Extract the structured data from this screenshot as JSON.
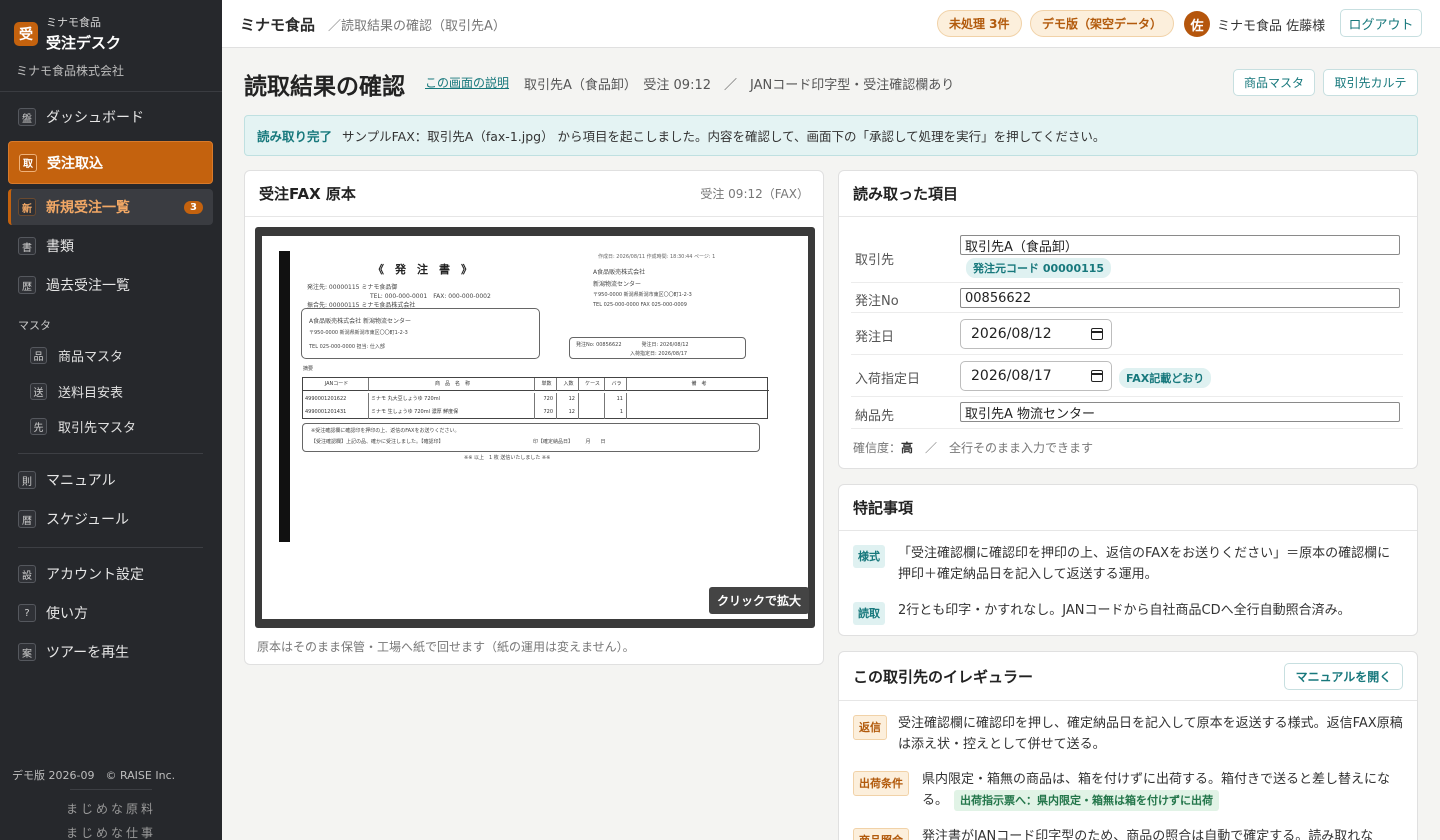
{
  "sidebar": {
    "brand_sub": "ミナモ食品",
    "brand_main": "受注デスク",
    "brand_logo": "受",
    "company": "ミナモ食品株式会社",
    "items": [
      {
        "icon": "盤",
        "label": "ダッシュボード"
      },
      {
        "icon": "取",
        "label": "受注取込"
      },
      {
        "icon": "新",
        "label": "新規受注一覧",
        "badge": "3"
      },
      {
        "icon": "書",
        "label": "書類"
      },
      {
        "icon": "歴",
        "label": "過去受注一覧"
      }
    ],
    "master_section": "マスタ",
    "master_items": [
      {
        "icon": "品",
        "label": "商品マスタ"
      },
      {
        "icon": "送",
        "label": "送料目安表"
      },
      {
        "icon": "先",
        "label": "取引先マスタ"
      }
    ],
    "items2": [
      {
        "icon": "則",
        "label": "マニュアル"
      },
      {
        "icon": "暦",
        "label": "スケジュール"
      }
    ],
    "items3": [
      {
        "icon": "設",
        "label": "アカウント設定"
      },
      {
        "icon": "?",
        "label": "使い方"
      },
      {
        "icon": "案",
        "label": "ツアーを再生"
      }
    ],
    "footer": "デモ版 2026-09　© RAISE Inc.",
    "tagline1": "まじめな原料",
    "tagline2": "まじめな仕事"
  },
  "topbar": {
    "title": "ミナモ食品",
    "crumb": "／読取結果の確認（取引先A）",
    "pending_badge": "未処理 3件",
    "demo_badge": "デモ版（架空データ）",
    "avatar": "佐",
    "user": "ミナモ食品 佐藤様",
    "logout": "ログアウト"
  },
  "header": {
    "title": "読取結果の確認",
    "explain_link": "この画面の説明",
    "meta": "取引先A（食品卸）　受注 09:12　／　JANコード印字型・受注確認欄あり",
    "btn_products": "商品マスタ",
    "btn_client": "取引先カルテ"
  },
  "banner": {
    "strong": "読み取り完了",
    "text": "サンプルFAX：取引先A（fax-1.jpg） から項目を起こしました。内容を確認して、画面下の「承認して処理を実行」を押してください。"
  },
  "fax": {
    "title": "受注FAX 原本",
    "meta": "受注 09:12（FAX）",
    "zoom": "クリックで拡大",
    "note": "原本はそのまま保管・工場へ紙で回せます（紙の運用は変えません）。",
    "doc": {
      "heading": "《　発　注　書　》",
      "header_right": "作成日: 2026/08/11 作成時間: 18:30:44 ページ: 1",
      "to1": "発注先: 00000115 ミナモ食品御",
      "to2": "TEL: 000-000-0001　FAX: 000-000-0002",
      "to3": "振合先: 00000115 ミナモ食品株式会社",
      "from1": "A食品販売株式会社",
      "from2": "新潟物流センター",
      "from3": "〒950-0000 新潟県新潟市東区〇〇町1-2-3",
      "from4": "TEL 025-000-0000 FAX 025-000-0009",
      "box1": "A食品販売株式会社 新潟物流センター",
      "box2": "〒950-0000 新潟県新潟市東区〇〇町1-2-3",
      "box3": "TEL 025-000-0000 担当: 仕入部",
      "box_order": "発注No: 00856622　　　　発注日: 2026/08/12",
      "box_arrival": "入荷指定日: 2026/08/17",
      "section": "摘要",
      "columns": [
        "JANコード",
        "商　品　名　称",
        "単数",
        "入数",
        "ケース",
        "バラ",
        "備　考"
      ],
      "rows": [
        [
          "4990001201622",
          "ミナモ 丸大豆しょうゆ 720ml",
          "720",
          "12",
          "",
          "11",
          ""
        ],
        [
          "4990001201431",
          "ミナモ 生しょうゆ 720ml 濃厚 鮮度保",
          "720",
          "12",
          "",
          "1",
          ""
        ]
      ],
      "footnote1": "※受注確認欄に確認印を押印の上、返信のFAXをお送りください。",
      "footnote2": "【受注確認欄】上記の品、確かに受注しました。【確認印】",
      "footnote2b": "印【確定納品日】　　　月　　日",
      "footnote3": "※※ 以上　1 枚 送信いたしました ※※"
    }
  },
  "fields": {
    "title": "読み取った項目",
    "client_label": "取引先",
    "client_value": "取引先A（食品卸）",
    "client_tag": "発注元コード 00000115",
    "order_label": "発注No",
    "order_value": "00856622",
    "date_label": "発注日",
    "date_value": "2026/08/12",
    "arrival_label": "入荷指定日",
    "arrival_value": "2026/08/17",
    "arrival_tag": "FAX記載どおり",
    "dest_label": "納品先",
    "dest_value": "取引先A 物流センター",
    "confidence_prefix": "確信度：",
    "confidence_value": "高",
    "confidence_suffix": "／　全行そのまま入力できます"
  },
  "notes": {
    "title": "特記事項",
    "items": [
      {
        "tag": "様式",
        "text": "「受注確認欄に確認印を押印の上、返信のFAXをお送りください」＝原本の確認欄に押印＋確定納品日を記入して返送する運用。"
      },
      {
        "tag": "読取",
        "text": "2行とも印字・かすれなし。JANコードから自社商品CDへ全行自動照合済み。"
      }
    ]
  },
  "irregular": {
    "title": "この取引先のイレギュラー",
    "manual_btn": "マニュアルを開く",
    "items": [
      {
        "tag": "返信",
        "text": "受注確認欄に確認印を押し、確定納品日を記入して原本を返送する様式。返信FAX原稿は添え状・控えとして併せて送る。"
      },
      {
        "tag": "出荷条件",
        "text": "県内限定・箱無の商品は、箱を付けずに出荷する。箱付きで送ると差し替えになる。",
        "extra": "出荷指示票へ：県内限定・箱無は箱を付けずに出荷"
      },
      {
        "tag": "商品照合",
        "text": "発注書がJANコード印字型のため、商品の照合は自動で確定する。読み取れな"
      }
    ]
  }
}
